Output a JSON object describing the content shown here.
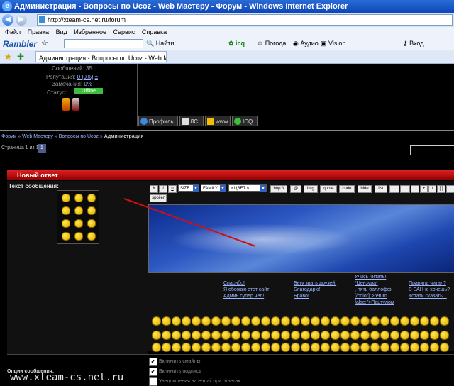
{
  "window": {
    "title": "Администрация - Вопросы по Ucoz - Web Мастеру - Форум - Windows Internet Explorer"
  },
  "address_bar": {
    "url": "http://xteam-cs.net.ru/forum"
  },
  "menu": [
    "Файл",
    "Правка",
    "Вид",
    "Избранное",
    "Сервис",
    "Справка"
  ],
  "toolbar": {
    "brand": "Rambler",
    "search_btn": "Найти!",
    "icq": "icq",
    "weather": "Погода",
    "audio": "Аудио",
    "vision": "Vision",
    "login": "Вход"
  },
  "tab": {
    "title": "Администрация - Вопросы по Ucoz - Web Мастеру - ..."
  },
  "profile": {
    "messages": "Сообщений: 35",
    "reputation_label": "Репутация:",
    "reputation_value": "0 [0%]",
    "remarks_label": "Замечания:",
    "remarks_value": "0%",
    "status_label": "Статус:",
    "status_value": "Offline"
  },
  "profile_buttons": [
    "Профиль",
    "ЛС",
    "www",
    "ICQ"
  ],
  "breadcrumb": {
    "forum": "Форум",
    "web": "Web Мастеру",
    "ucoz": "Вопросы по Ucoz",
    "current": "Администрация"
  },
  "pager": {
    "text": "Страница 1 из 1",
    "page": "1"
  },
  "new_post": {
    "title": "Новый ответ"
  },
  "message_label": "Текст сообщения:",
  "bbcode": {
    "buttons": [
      "b",
      "i",
      "u",
      "http://",
      "@",
      "img",
      "quote",
      "code",
      "hide",
      "list",
      "...",
      "...",
      "...",
      "+",
      "/",
      "[:]",
      "..."
    ],
    "size": "SIZE",
    "family": "FAMILY",
    "color": "« ЦВЕТ »",
    "spoiler": "spoiler"
  },
  "phrases": {
    "col1": [
      "Спасибо!",
      "Я обожаю этот сайт!",
      "Админ супер чел!"
    ],
    "col2": [
      "Бегу звать друзей!",
      "Благодарю!",
      "Браво!"
    ],
    "col3": [
      "Учись читать!",
      "*Цензура*",
      ", пять баллофф!",
      "[/color]\">return",
      "false;\">Пацтулом"
    ],
    "col4": [
      "Правила читал?",
      "В БАН-ю хочешь?",
      "Кстати сказать..."
    ]
  },
  "options": {
    "label": "Опции сообщения:",
    "smiles": "Включить смайлы",
    "signature": "Включить подпись",
    "notify": "Уведомления на e-mail при ответах"
  },
  "watermark": "www.xteam-cs.net.ru",
  "colors": {
    "accent_red": "#c00000",
    "link": "#9ab4ff",
    "ie_blue": "#0d46b8"
  }
}
